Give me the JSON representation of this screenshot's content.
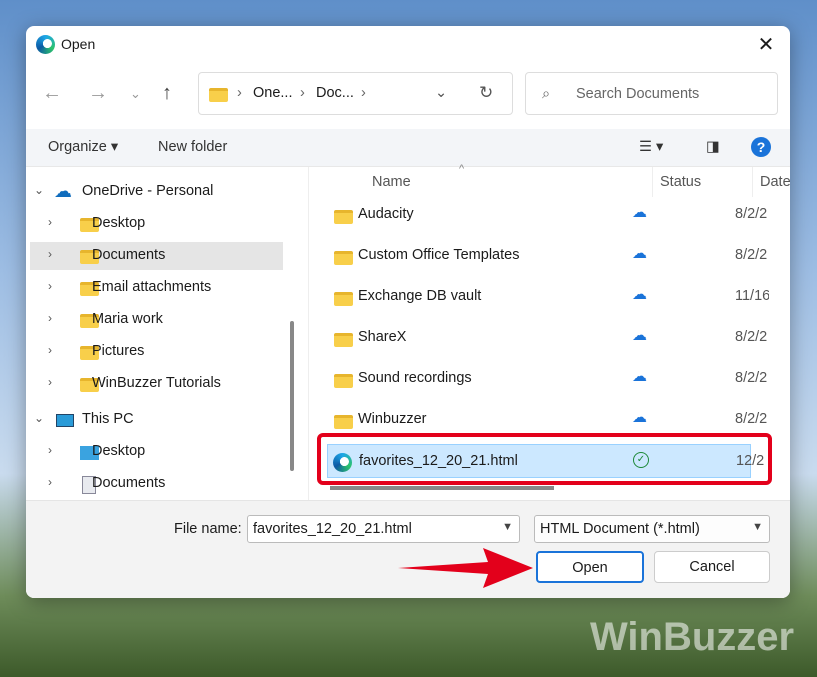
{
  "title": "Open",
  "address": {
    "crumbs": [
      "One...",
      "Doc..."
    ]
  },
  "search": {
    "placeholder": "Search Documents"
  },
  "toolbar": {
    "organize": "Organize",
    "new_folder": "New folder",
    "help": "?"
  },
  "tree": [
    {
      "label": "OneDrive - Personal",
      "level": 0,
      "expanded": true,
      "icon": "onedrive-cloud"
    },
    {
      "label": "Desktop",
      "level": 1,
      "icon": "folder"
    },
    {
      "label": "Documents",
      "level": 1,
      "icon": "folder",
      "selected": true
    },
    {
      "label": "Email attachments",
      "level": 1,
      "icon": "folder"
    },
    {
      "label": "Maria work",
      "level": 1,
      "icon": "folder"
    },
    {
      "label": "Pictures",
      "level": 1,
      "icon": "folder"
    },
    {
      "label": "WinBuzzer Tutorials",
      "level": 1,
      "icon": "folder"
    },
    {
      "label": "This PC",
      "level": 0,
      "expanded": true,
      "icon": "monitor"
    },
    {
      "label": "Desktop",
      "level": 1,
      "icon": "desktop"
    },
    {
      "label": "Documents",
      "level": 1,
      "icon": "document"
    }
  ],
  "columns": {
    "name": "Name",
    "status": "Status",
    "date": "Date"
  },
  "files": [
    {
      "name": "Audacity",
      "date": "8/2/2",
      "status": "cloud"
    },
    {
      "name": "Custom Office Templates",
      "date": "8/2/2",
      "status": "cloud"
    },
    {
      "name": "Exchange DB vault",
      "date": "11/16",
      "status": "cloud"
    },
    {
      "name": "ShareX",
      "date": "8/2/2",
      "status": "cloud"
    },
    {
      "name": "Sound recordings",
      "date": "8/2/2",
      "status": "cloud"
    },
    {
      "name": "Winbuzzer",
      "date": "8/2/2",
      "status": "cloud"
    },
    {
      "name": "favorites_12_20_21.html",
      "date": "12/2",
      "status": "synced",
      "selected": true
    }
  ],
  "footer": {
    "file_name_label": "File name:",
    "file_name_value": "favorites_12_20_21.html",
    "file_type": "HTML Document (*.html)",
    "open": "Open",
    "cancel": "Cancel"
  },
  "watermark": "WinBuzzer"
}
